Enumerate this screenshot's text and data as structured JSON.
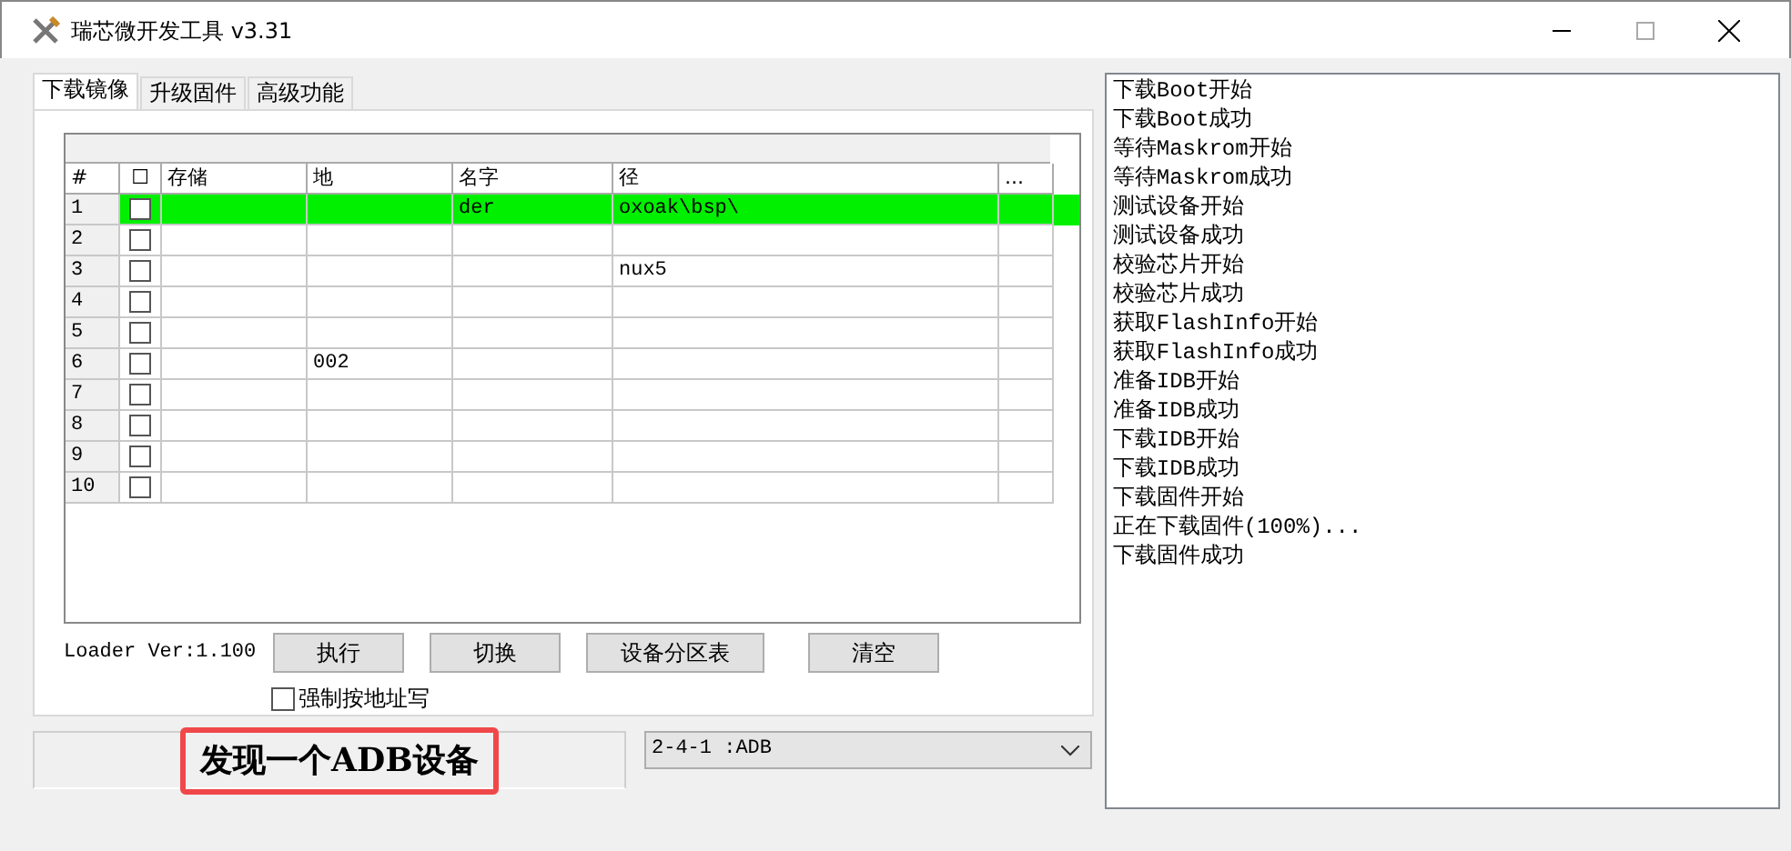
{
  "window": {
    "title": "瑞芯微开发工具 v3.31"
  },
  "tabs": [
    {
      "label": "下载镜像",
      "selected": true
    },
    {
      "label": "升级固件",
      "selected": false
    },
    {
      "label": "高级功能",
      "selected": false
    }
  ],
  "table": {
    "columns": [
      "#",
      "☐",
      "存储",
      "地",
      "名字",
      "径",
      "..."
    ],
    "rows": [
      {
        "cells": [
          "1",
          "",
          "",
          "",
          "der",
          "oxoak\\bsp\\",
          "",
          ""
        ],
        "checked": false,
        "selected": true
      },
      {
        "cells": [
          "2",
          "",
          "",
          "",
          "",
          "",
          "",
          ""
        ],
        "checked": false,
        "selected": false
      },
      {
        "cells": [
          "3",
          "",
          "",
          "",
          "",
          "nux5",
          "",
          ""
        ],
        "checked": false,
        "selected": false
      },
      {
        "cells": [
          "4",
          "",
          "",
          "",
          "",
          "",
          "",
          ""
        ],
        "checked": false,
        "selected": false
      },
      {
        "cells": [
          "5",
          "",
          "",
          "",
          "",
          "",
          "",
          ""
        ],
        "checked": false,
        "selected": false
      },
      {
        "cells": [
          "6",
          "",
          "",
          "002",
          "",
          "",
          "",
          ""
        ],
        "checked": false,
        "selected": false
      },
      {
        "cells": [
          "7",
          "",
          "",
          "",
          "",
          "",
          "",
          ""
        ],
        "checked": false,
        "selected": false
      },
      {
        "cells": [
          "8",
          "",
          "",
          "",
          "",
          "",
          "",
          ""
        ],
        "checked": false,
        "selected": false
      },
      {
        "cells": [
          "9",
          "",
          "",
          "",
          "",
          "",
          "",
          ""
        ],
        "checked": false,
        "selected": false
      },
      {
        "cells": [
          "10",
          "",
          "",
          "",
          "",
          "",
          "",
          ""
        ],
        "checked": false,
        "selected": false
      }
    ]
  },
  "loader_version": "Loader Ver:1.100",
  "buttons": [
    "执行",
    "切换",
    "设备分区表",
    "清空"
  ],
  "force_address": {
    "label": "强制按地址写",
    "checked": false
  },
  "status": {
    "text": "发现一个ADB设备",
    "highlighted": true
  },
  "device_select": {
    "value": "2-4-1 :ADB"
  },
  "log": [
    "下载Boot开始",
    "下载Boot成功",
    "等待Maskrom开始",
    "等待Maskrom成功",
    "测试设备开始",
    "测试设备成功",
    "校验芯片开始",
    "校验芯片成功",
    "获取FlashInfo开始",
    "获取FlashInfo成功",
    "准备IDB开始",
    "准备IDB成功",
    "下载IDB开始",
    "下载IDB成功",
    "下载固件开始",
    "正在下载固件(100%)...",
    "下载固件成功"
  ]
}
